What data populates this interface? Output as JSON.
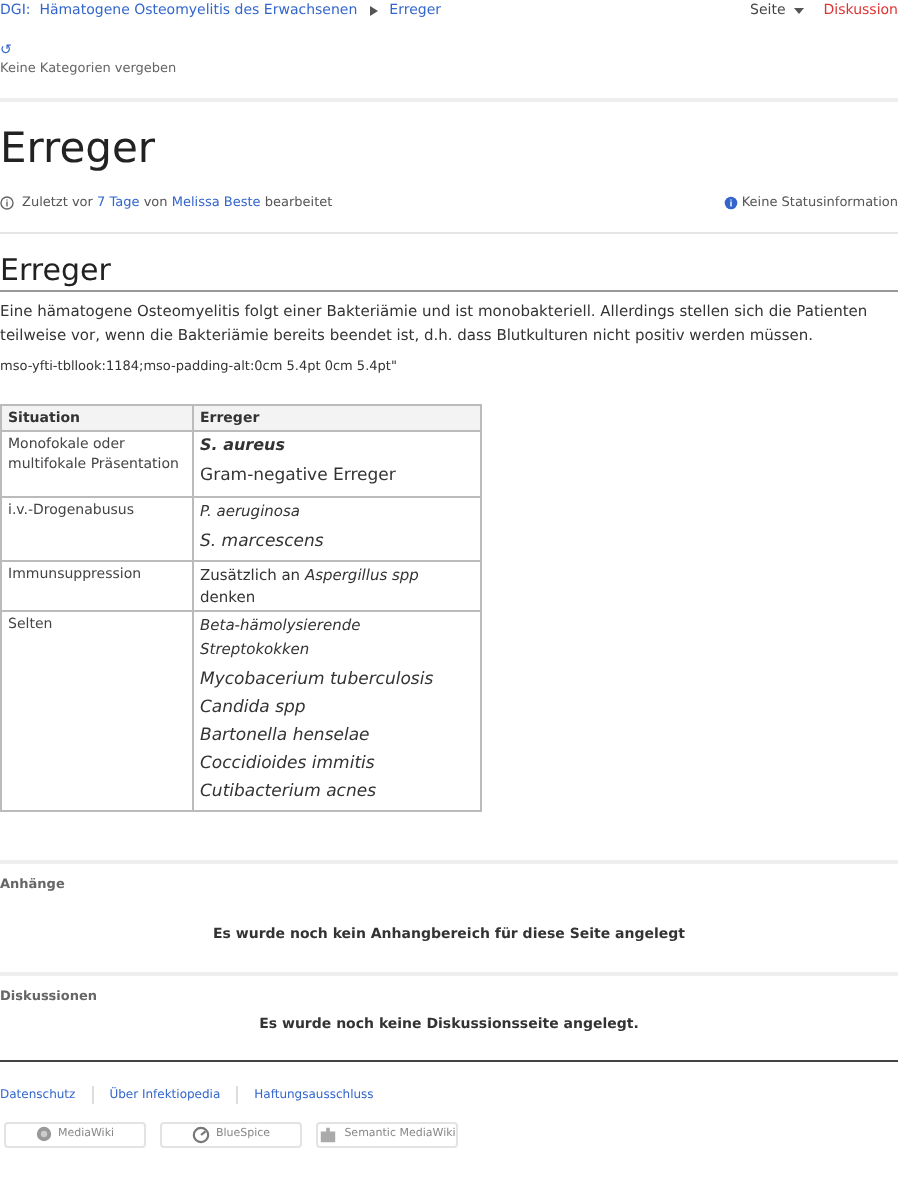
{
  "breadcrumb": {
    "items": [
      {
        "label": "DGI:  Hämatogene Osteomyelitis des Erwachsenen"
      },
      {
        "label": "Erreger"
      }
    ],
    "page_menu": "Seite",
    "discussion_link": "Diskussion"
  },
  "categories": {
    "icon_text": "↺",
    "text": "Keine Kategorien vergeben"
  },
  "title": "Erreger",
  "meta": {
    "prefix": "Zuletzt vor",
    "time_link": "7 Tage",
    "by": "von",
    "author_link": "Melissa Beste",
    "suffix": "bearbeitet",
    "status": "Keine Statusinformation"
  },
  "section": {
    "heading": "Erreger",
    "paragraph": "Eine hämatogene Osteomyelitis folgt einer Bakteriämie und ist monobakteriell. Allerdings stellen sich die Patienten teilweise vor, wenn die Bakteriämie bereits beendet ist, d.h. dass Blutkulturen nicht positiv werden müssen.",
    "code_note": "mso-yfti-tbllook:1184;mso-padding-alt:0cm 5.4pt 0cm 5.4pt\""
  },
  "table": {
    "columns": [
      "Situation",
      "Erreger"
    ],
    "rows": [
      {
        "situation": "Monofokale oder multifokale Präsentation",
        "pathogens": [
          {
            "kind": "bold_italic",
            "text": "S. aureus"
          },
          {
            "kind": "plain",
            "text": "Gram-negative Erreger"
          }
        ]
      },
      {
        "situation": "i.v.-Drogenabusus",
        "pathogens": [
          {
            "kind": "italic_small",
            "text": "P. aeruginosa"
          },
          {
            "kind": "italic",
            "text": "S. marcescens"
          }
        ]
      },
      {
        "situation": "Immunsuppression",
        "pathogens": [
          {
            "kind": "rich",
            "text": "Zusätzlich an *Aspergillus spp* denken"
          }
        ]
      },
      {
        "situation": "Selten",
        "pathogens": [
          {
            "kind": "italic_small",
            "text": "Beta-hämolysierende Streptokokken"
          },
          {
            "kind": "italic",
            "text": "Mycobacerium tuberculosis"
          },
          {
            "kind": "italic",
            "text": "Candida spp"
          },
          {
            "kind": "italic",
            "text": "Bartonella henselae"
          },
          {
            "kind": "italic",
            "text": "Coccidioides immitis"
          },
          {
            "kind": "italic",
            "text": "Cutibacterium acnes"
          }
        ]
      }
    ]
  },
  "attachments": {
    "heading": "Anhänge",
    "message": "Es wurde noch kein Anhangbereich für diese Seite angelegt"
  },
  "discussions": {
    "heading": "Diskussionen",
    "message": "Es wurde noch keine Diskussionsseite angelegt."
  },
  "footer": {
    "links": [
      "Datenschutz",
      "Über Infektiopedia",
      "Haftungsausschluss"
    ],
    "badges": [
      {
        "kind": "mediawiki",
        "label": "MediaWiki"
      },
      {
        "kind": "bluespice",
        "label": "BlueSpice"
      },
      {
        "kind": "smw",
        "label": "Semantic MediaWiki"
      }
    ]
  }
}
